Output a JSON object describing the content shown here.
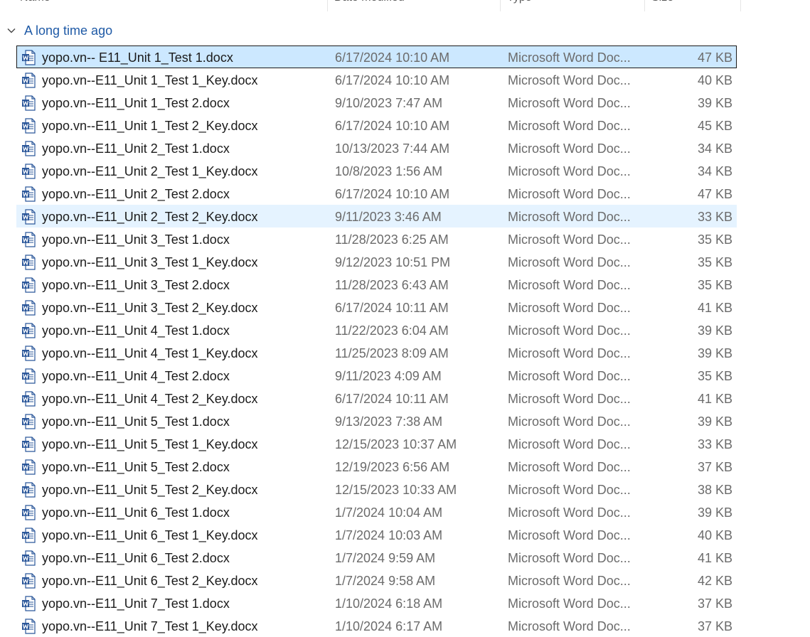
{
  "columns": {
    "name": "Name",
    "date": "Date modified",
    "type": "Type",
    "size": "Size"
  },
  "group": {
    "label": "A long time ago"
  },
  "icons": {
    "collapse": "chevron-down-icon",
    "file": "word-doc-icon"
  },
  "colors": {
    "word_blue": "#2b579a",
    "selected_bg": "#cce8ff",
    "hover_bg": "#e5f3ff",
    "group_text": "#1f5aa6"
  },
  "files": [
    {
      "name": "yopo.vn-- E11_Unit 1_Test 1.docx",
      "date": "6/17/2024 10:10 AM",
      "type": "Microsoft Word Doc...",
      "size": "47 KB",
      "state": "selected"
    },
    {
      "name": "yopo.vn--E11_Unit 1_Test 1_Key.docx",
      "date": "6/17/2024 10:10 AM",
      "type": "Microsoft Word Doc...",
      "size": "40 KB"
    },
    {
      "name": "yopo.vn--E11_Unit 1_Test 2.docx",
      "date": "9/10/2023 7:47 AM",
      "type": "Microsoft Word Doc...",
      "size": "39 KB"
    },
    {
      "name": "yopo.vn--E11_Unit 1_Test 2_Key.docx",
      "date": "6/17/2024 10:10 AM",
      "type": "Microsoft Word Doc...",
      "size": "45 KB"
    },
    {
      "name": "yopo.vn--E11_Unit 2_Test 1.docx",
      "date": "10/13/2023 7:44 AM",
      "type": "Microsoft Word Doc...",
      "size": "34 KB"
    },
    {
      "name": "yopo.vn--E11_Unit 2_Test 1_Key.docx",
      "date": "10/8/2023 1:56 AM",
      "type": "Microsoft Word Doc...",
      "size": "34 KB"
    },
    {
      "name": "yopo.vn--E11_Unit 2_Test 2.docx",
      "date": "6/17/2024 10:10 AM",
      "type": "Microsoft Word Doc...",
      "size": "47 KB"
    },
    {
      "name": "yopo.vn--E11_Unit 2_Test 2_Key.docx",
      "date": "9/11/2023 3:46 AM",
      "type": "Microsoft Word Doc...",
      "size": "33 KB",
      "state": "hovered"
    },
    {
      "name": "yopo.vn--E11_Unit 3_Test 1.docx",
      "date": "11/28/2023 6:25 AM",
      "type": "Microsoft Word Doc...",
      "size": "35 KB"
    },
    {
      "name": "yopo.vn--E11_Unit 3_Test 1_Key.docx",
      "date": "9/12/2023 10:51 PM",
      "type": "Microsoft Word Doc...",
      "size": "35 KB"
    },
    {
      "name": "yopo.vn--E11_Unit 3_Test 2.docx",
      "date": "11/28/2023 6:43 AM",
      "type": "Microsoft Word Doc...",
      "size": "35 KB"
    },
    {
      "name": "yopo.vn--E11_Unit 3_Test 2_Key.docx",
      "date": "6/17/2024 10:11 AM",
      "type": "Microsoft Word Doc...",
      "size": "41 KB"
    },
    {
      "name": "yopo.vn--E11_Unit 4_Test 1.docx",
      "date": "11/22/2023 6:04 AM",
      "type": "Microsoft Word Doc...",
      "size": "39 KB"
    },
    {
      "name": "yopo.vn--E11_Unit 4_Test 1_Key.docx",
      "date": "11/25/2023 8:09 AM",
      "type": "Microsoft Word Doc...",
      "size": "39 KB"
    },
    {
      "name": "yopo.vn--E11_Unit 4_Test 2.docx",
      "date": "9/11/2023 4:09 AM",
      "type": "Microsoft Word Doc...",
      "size": "35 KB"
    },
    {
      "name": "yopo.vn--E11_Unit 4_Test 2_Key.docx",
      "date": "6/17/2024 10:11 AM",
      "type": "Microsoft Word Doc...",
      "size": "41 KB"
    },
    {
      "name": "yopo.vn--E11_Unit 5_Test 1.docx",
      "date": "9/13/2023 7:38 AM",
      "type": "Microsoft Word Doc...",
      "size": "39 KB"
    },
    {
      "name": "yopo.vn--E11_Unit 5_Test 1_Key.docx",
      "date": "12/15/2023 10:37 AM",
      "type": "Microsoft Word Doc...",
      "size": "33 KB"
    },
    {
      "name": "yopo.vn--E11_Unit 5_Test 2.docx",
      "date": "12/19/2023 6:56 AM",
      "type": "Microsoft Word Doc...",
      "size": "37 KB"
    },
    {
      "name": "yopo.vn--E11_Unit 5_Test 2_Key.docx",
      "date": "12/15/2023 10:33 AM",
      "type": "Microsoft Word Doc...",
      "size": "38 KB"
    },
    {
      "name": "yopo.vn--E11_Unit 6_Test 1.docx",
      "date": "1/7/2024 10:04 AM",
      "type": "Microsoft Word Doc...",
      "size": "39 KB"
    },
    {
      "name": "yopo.vn--E11_Unit 6_Test 1_Key.docx",
      "date": "1/7/2024 10:03 AM",
      "type": "Microsoft Word Doc...",
      "size": "40 KB"
    },
    {
      "name": "yopo.vn--E11_Unit 6_Test 2.docx",
      "date": "1/7/2024 9:59 AM",
      "type": "Microsoft Word Doc...",
      "size": "41 KB"
    },
    {
      "name": "yopo.vn--E11_Unit 6_Test 2_Key.docx",
      "date": "1/7/2024 9:58 AM",
      "type": "Microsoft Word Doc...",
      "size": "42 KB"
    },
    {
      "name": "yopo.vn--E11_Unit 7_Test 1.docx",
      "date": "1/10/2024 6:18 AM",
      "type": "Microsoft Word Doc...",
      "size": "37 KB"
    },
    {
      "name": "yopo.vn--E11_Unit 7_Test 1_Key.docx",
      "date": "1/10/2024 6:17 AM",
      "type": "Microsoft Word Doc...",
      "size": "37 KB"
    }
  ]
}
